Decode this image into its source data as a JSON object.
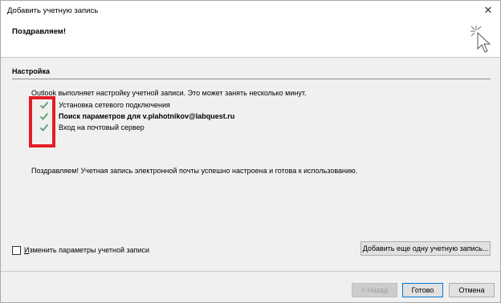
{
  "window": {
    "title": "Добавить учетную запись",
    "close_glyph": "✕"
  },
  "header": {
    "heading": "Поздравляем!"
  },
  "section": {
    "label": "Настройка",
    "intro": "Outlook выполняет настройку учетной записи. Это может занять несколько минут."
  },
  "steps": [
    {
      "label": "Установка сетевого подключения",
      "status": "done",
      "bold": false
    },
    {
      "label": "Поиск параметров для v.plahotnikov@labquest.ru",
      "status": "done",
      "bold": true
    },
    {
      "label": "Вход на почтовый сервер",
      "status": "done",
      "bold": false
    }
  ],
  "success_message": "Поздравляем! Учетная запись электронной почты успешно настроена и готова к использованию.",
  "change_settings": {
    "label_prefix": "И",
    "label_rest": "зменить параметры учетной записи",
    "checked": false
  },
  "buttons": {
    "add_account_prefix": "Д",
    "add_account_rest": "обавить еще одну учетную запись...",
    "back": "< Назад",
    "done": "Готово",
    "cancel": "Отмена"
  },
  "colors": {
    "check": "#5a9e6f",
    "highlight": "#e31e24",
    "primary_border": "#0078d7"
  },
  "icons": {
    "header": "wizard-cursor-icon",
    "step": "checkmark-icon"
  }
}
